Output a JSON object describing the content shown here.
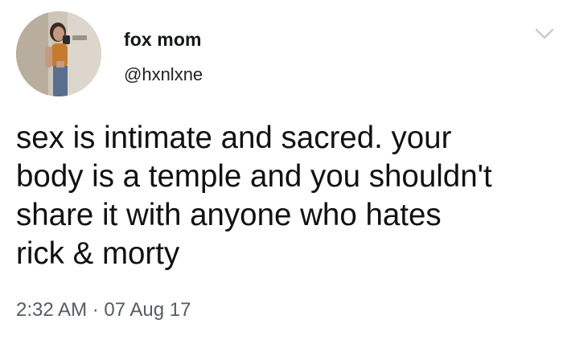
{
  "tweet": {
    "author": {
      "display_name": "fox mom",
      "handle": "@hxnlxne",
      "avatar_icon": "profile-photo-avatar"
    },
    "menu_icon": "chevron-down-icon",
    "text": "sex is intimate and sacred. your\nbody is a temple and you shouldn't\nshare it with anyone who hates\nrick & morty",
    "timestamp": "2:32 AM · 07 Aug 17"
  },
  "colors": {
    "background": "#ffffff",
    "text": "#111111",
    "meta": "#555b61",
    "caret": "#c5cbd1"
  }
}
